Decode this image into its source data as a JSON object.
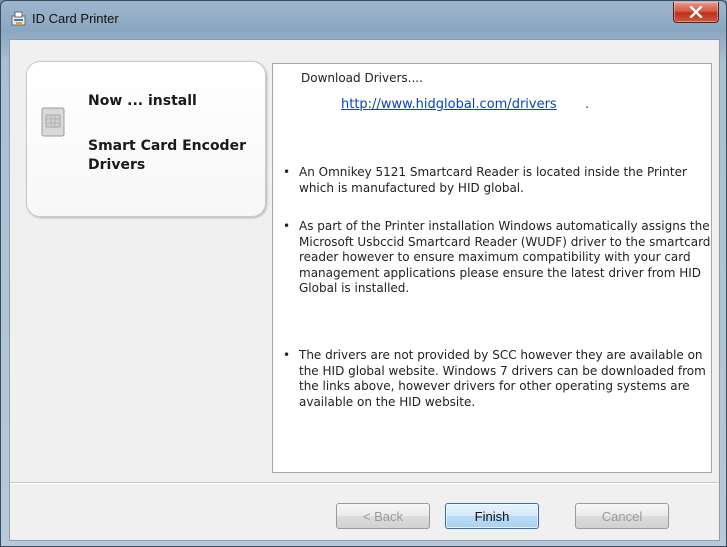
{
  "window": {
    "title": "ID Card Printer",
    "close_glyph": "✕"
  },
  "side_card": {
    "heading": "Now ... install",
    "subheading": "Smart Card Encoder Drivers",
    "icon": "smartcard-icon"
  },
  "content": {
    "download_heading": "Download Drivers....",
    "download_link": "http://www.hidglobal.com/drivers",
    "download_link_suffix": ".",
    "bullets": [
      "An Omnikey 5121 Smartcard Reader is located inside the Printer which is manufactured by HID global.",
      "As part of the Printer installation Windows automatically assigns the Microsoft Usbccid Smartcard Reader (WUDF) driver to the smartcard reader however to ensure maximum compatibility with your card management applications please ensure the latest driver from HID Global is installed.",
      "The drivers are not provided by SCC however they are available on the HID global website. Windows 7 drivers can be downloaded from the links above, however drivers for other operating systems are available on the HID website."
    ],
    "bullet_glyph": "•"
  },
  "buttons": {
    "back": "< Back",
    "finish": "Finish",
    "cancel": "Cancel"
  }
}
